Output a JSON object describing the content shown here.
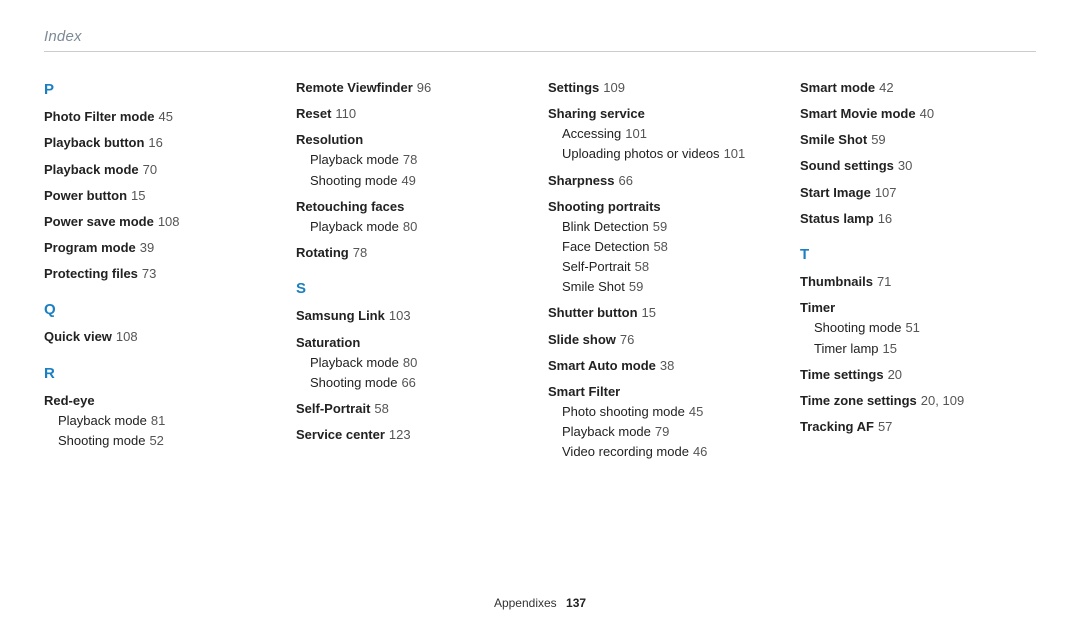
{
  "header": "Index",
  "footer": {
    "label": "Appendixes",
    "page": "137"
  },
  "columns": [
    [
      {
        "letter": "P"
      },
      {
        "main": "Photo Filter mode",
        "page": "45"
      },
      {
        "main": "Playback button",
        "page": "16"
      },
      {
        "main": "Playback mode",
        "page": "70"
      },
      {
        "main": "Power button",
        "page": "15"
      },
      {
        "main": "Power save mode",
        "page": "108"
      },
      {
        "main": "Program mode",
        "page": "39"
      },
      {
        "main": "Protecting files",
        "page": "73"
      },
      {
        "letter": "Q"
      },
      {
        "main": "Quick view",
        "page": "108"
      },
      {
        "letter": "R"
      },
      {
        "main": "Red-eye",
        "subs": [
          {
            "label": "Playback mode",
            "page": "81"
          },
          {
            "label": "Shooting mode",
            "page": "52"
          }
        ]
      }
    ],
    [
      {
        "main": "Remote Viewfinder",
        "page": "96"
      },
      {
        "main": "Reset",
        "page": "110"
      },
      {
        "main": "Resolution",
        "subs": [
          {
            "label": "Playback mode",
            "page": "78"
          },
          {
            "label": "Shooting mode",
            "page": "49"
          }
        ]
      },
      {
        "main": "Retouching faces",
        "subs": [
          {
            "label": "Playback mode",
            "page": "80"
          }
        ]
      },
      {
        "main": "Rotating",
        "page": "78"
      },
      {
        "letter": "S"
      },
      {
        "main": "Samsung Link",
        "page": "103"
      },
      {
        "main": "Saturation",
        "subs": [
          {
            "label": "Playback mode",
            "page": "80"
          },
          {
            "label": "Shooting mode",
            "page": "66"
          }
        ]
      },
      {
        "main": "Self-Portrait",
        "page": "58"
      },
      {
        "main": "Service center",
        "page": "123"
      }
    ],
    [
      {
        "main": "Settings",
        "page": "109"
      },
      {
        "main": "Sharing service",
        "subs": [
          {
            "label": "Accessing",
            "page": "101"
          },
          {
            "label": "Uploading photos or videos",
            "page": "101"
          }
        ]
      },
      {
        "main": "Sharpness",
        "page": "66"
      },
      {
        "main": "Shooting portraits",
        "subs": [
          {
            "label": "Blink Detection",
            "page": "59"
          },
          {
            "label": "Face Detection",
            "page": "58"
          },
          {
            "label": "Self-Portrait",
            "page": "58"
          },
          {
            "label": "Smile Shot",
            "page": "59"
          }
        ]
      },
      {
        "main": "Shutter button",
        "page": "15"
      },
      {
        "main": "Slide show",
        "page": "76"
      },
      {
        "main": "Smart Auto mode",
        "page": "38"
      },
      {
        "main": "Smart Filter",
        "subs": [
          {
            "label": "Photo shooting mode",
            "page": "45"
          },
          {
            "label": "Playback mode",
            "page": "79"
          },
          {
            "label": "Video recording mode",
            "page": "46"
          }
        ]
      }
    ],
    [
      {
        "main": "Smart mode",
        "page": "42"
      },
      {
        "main": "Smart Movie mode",
        "page": "40"
      },
      {
        "main": "Smile Shot",
        "page": "59"
      },
      {
        "main": "Sound settings",
        "page": "30"
      },
      {
        "main": "Start Image",
        "page": "107"
      },
      {
        "main": "Status lamp",
        "page": "16"
      },
      {
        "letter": "T"
      },
      {
        "main": "Thumbnails",
        "page": "71"
      },
      {
        "main": "Timer",
        "subs": [
          {
            "label": "Shooting mode",
            "page": "51"
          },
          {
            "label": "Timer lamp",
            "page": "15"
          }
        ]
      },
      {
        "main": "Time settings",
        "page": "20"
      },
      {
        "main": "Time zone settings",
        "page": "20, 109"
      },
      {
        "main": "Tracking AF",
        "page": "57"
      }
    ]
  ]
}
